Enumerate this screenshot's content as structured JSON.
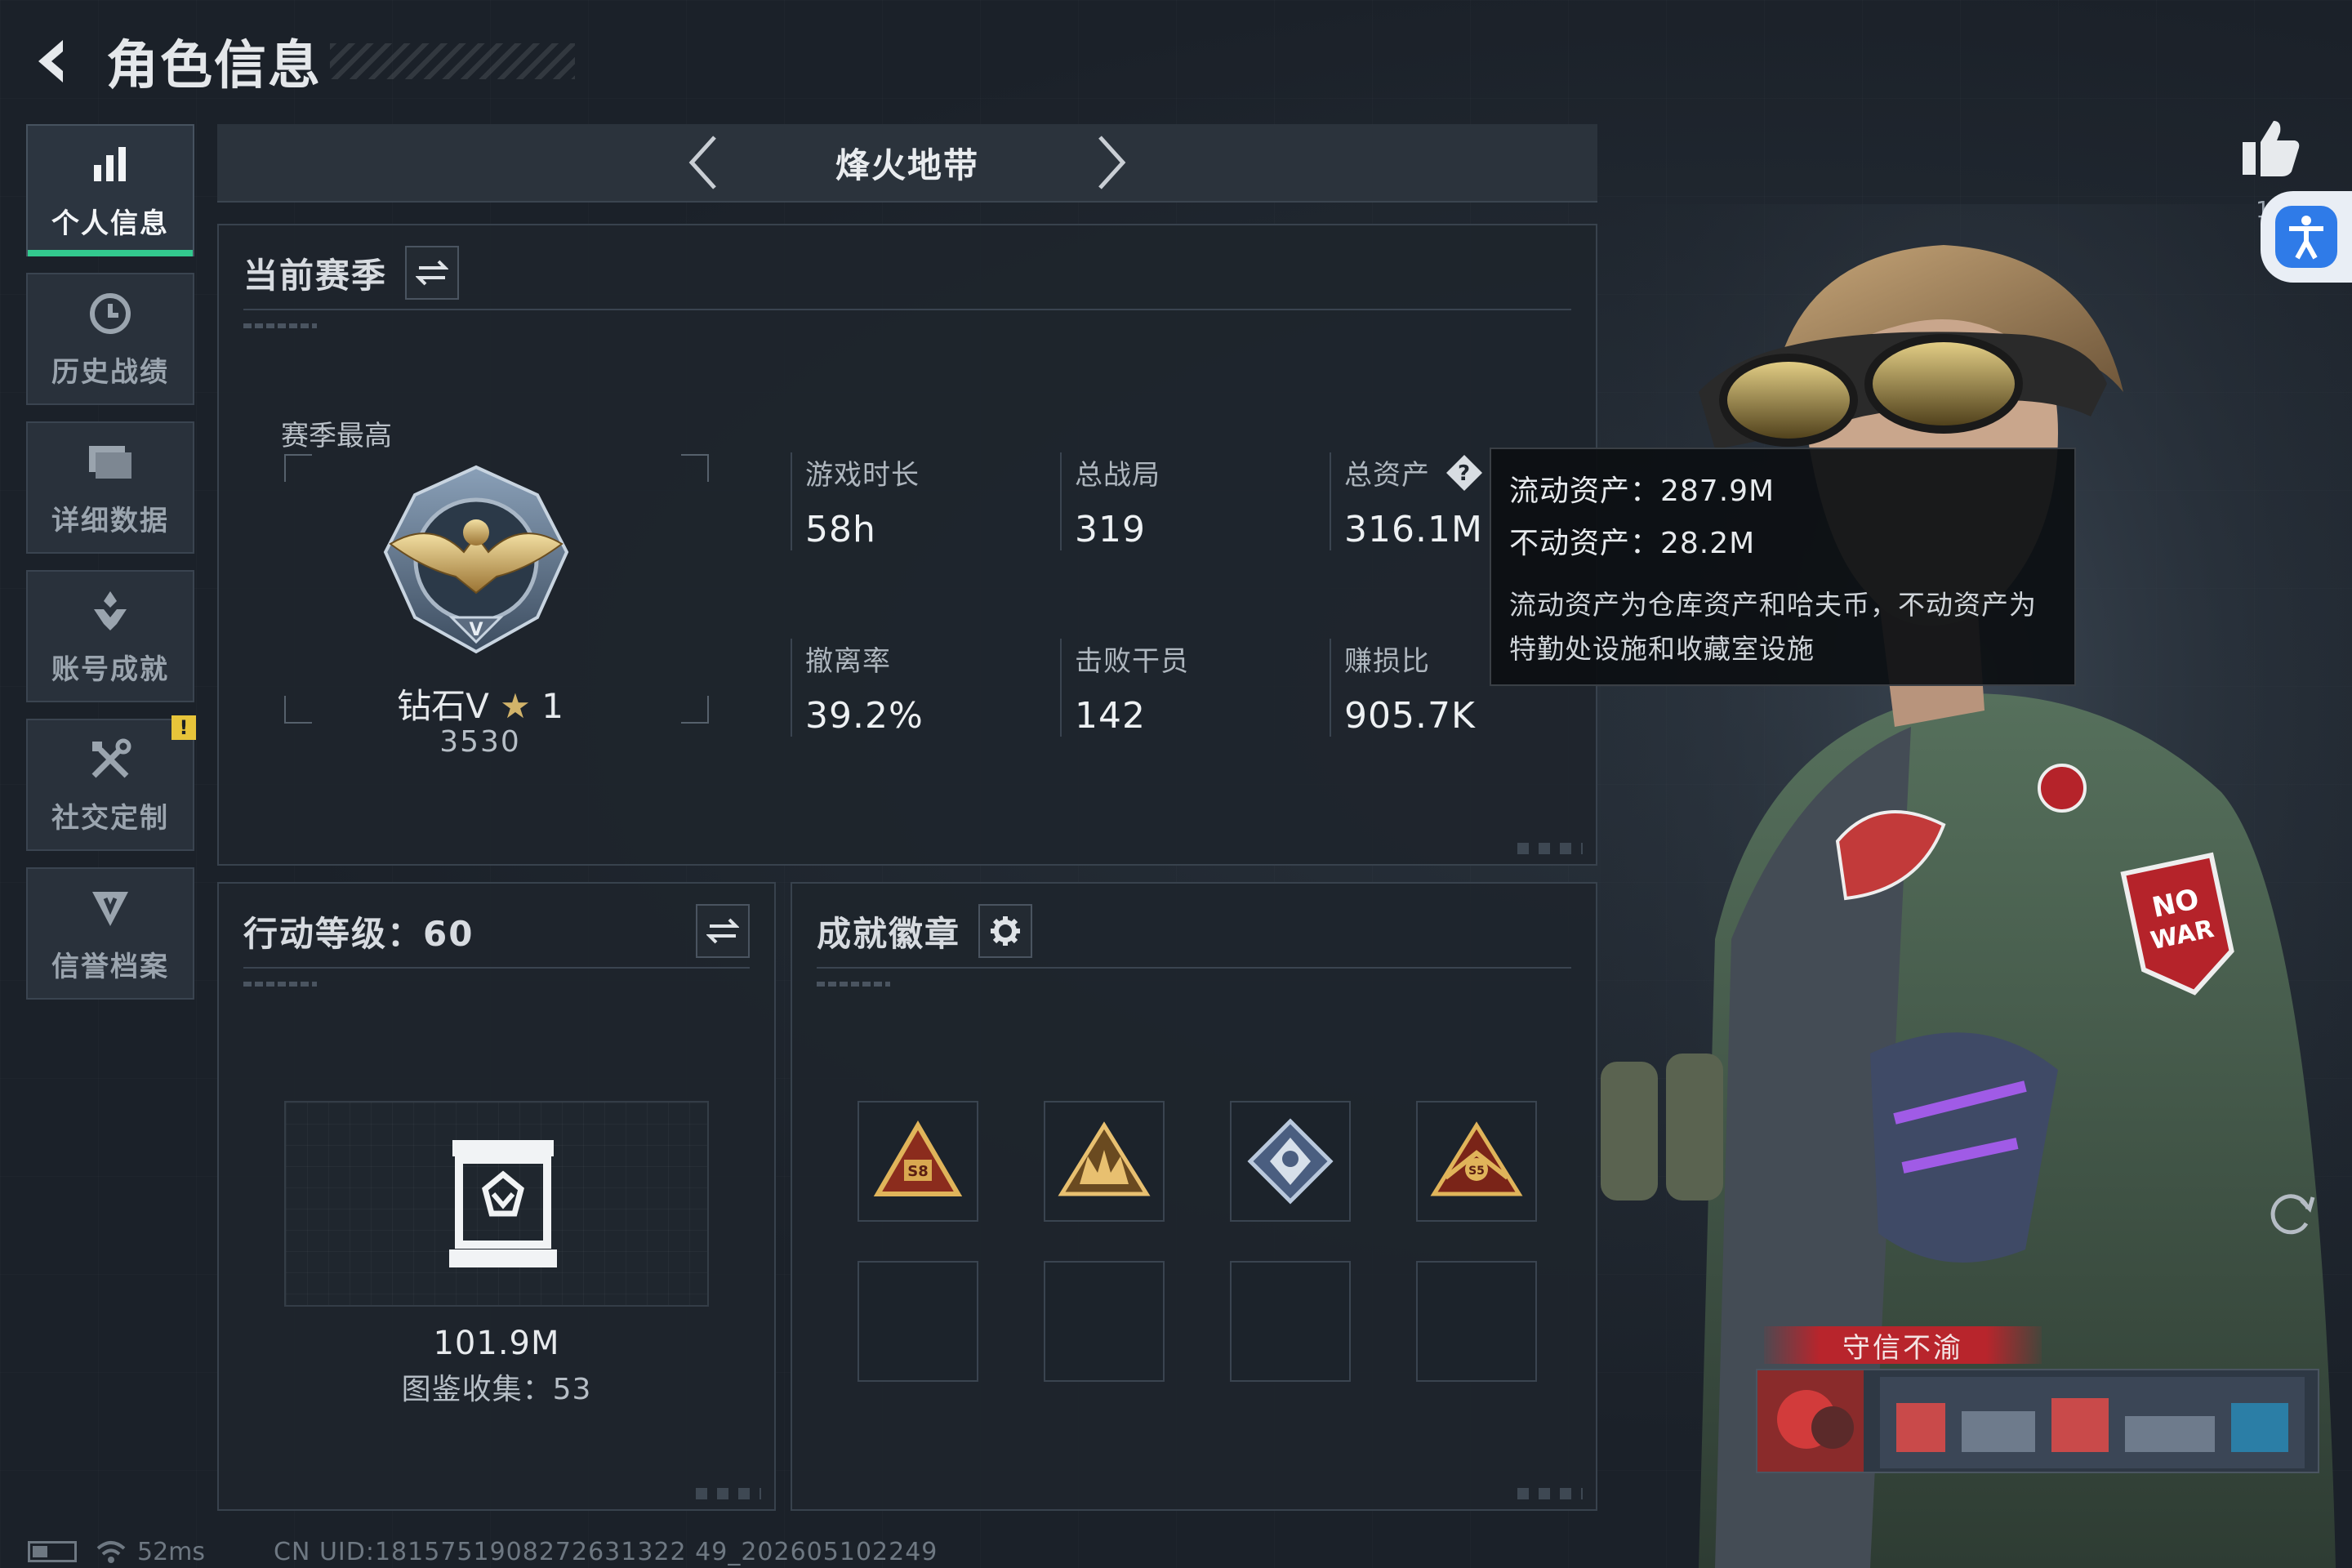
{
  "header": {
    "title": "角色信息"
  },
  "sidebar": {
    "items": [
      {
        "label": "个人信息",
        "icon": "bar-chart-icon",
        "active": true
      },
      {
        "label": "历史战绩",
        "icon": "history-clock-icon",
        "active": false
      },
      {
        "label": "详细数据",
        "icon": "data-folder-icon",
        "active": false
      },
      {
        "label": "账号成就",
        "icon": "achievement-icon",
        "active": false
      },
      {
        "label": "社交定制",
        "icon": "tools-icon",
        "active": false,
        "badge": "!"
      },
      {
        "label": "信誉档案",
        "icon": "credit-shield-icon",
        "active": false
      }
    ]
  },
  "mode": {
    "title": "烽火地带"
  },
  "season": {
    "title": "当前赛季",
    "peak_label": "赛季最高",
    "rank_name": "钻石V",
    "rank_star": "★",
    "rank_stars": "1",
    "rank_score": "3530",
    "stats": [
      {
        "label": "游戏时长",
        "value": "58h"
      },
      {
        "label": "总战局",
        "value": "319"
      },
      {
        "label": "总资产",
        "value": "316.1M"
      },
      {
        "label": "撤离率",
        "value": "39.2%"
      },
      {
        "label": "击败干员",
        "value": "142"
      },
      {
        "label": "赚损比",
        "value": "905.7K"
      }
    ]
  },
  "tooltip": {
    "liquid": "流动资产：287.9M",
    "fixed": "不动资产：28.2M",
    "desc": "流动资产为仓库资产和哈夫币，不动资产为特勤处设施和收藏室设施"
  },
  "action_level": {
    "title": "行动等级：60",
    "asset_value": "101.9M",
    "collection": "图鉴收集：53"
  },
  "badges": {
    "title": "成就徽章",
    "items": [
      {
        "icon": "s8-season-badge-icon"
      },
      {
        "icon": "gold-crown-badge-icon"
      },
      {
        "icon": "diamond-crest-badge-icon"
      },
      {
        "icon": "s5-season-badge-icon"
      }
    ]
  },
  "character": {
    "likes": "1",
    "credit_title": "守信不渝"
  },
  "status_bar": {
    "ping": "52ms",
    "uid": "CN UID:1815751908272631322 49_202605102249"
  },
  "colors": {
    "accent_green": "#33c98e",
    "warn_yellow": "#e7c43a",
    "credit_red": "#b8252c",
    "access_blue": "#2f7be8"
  }
}
